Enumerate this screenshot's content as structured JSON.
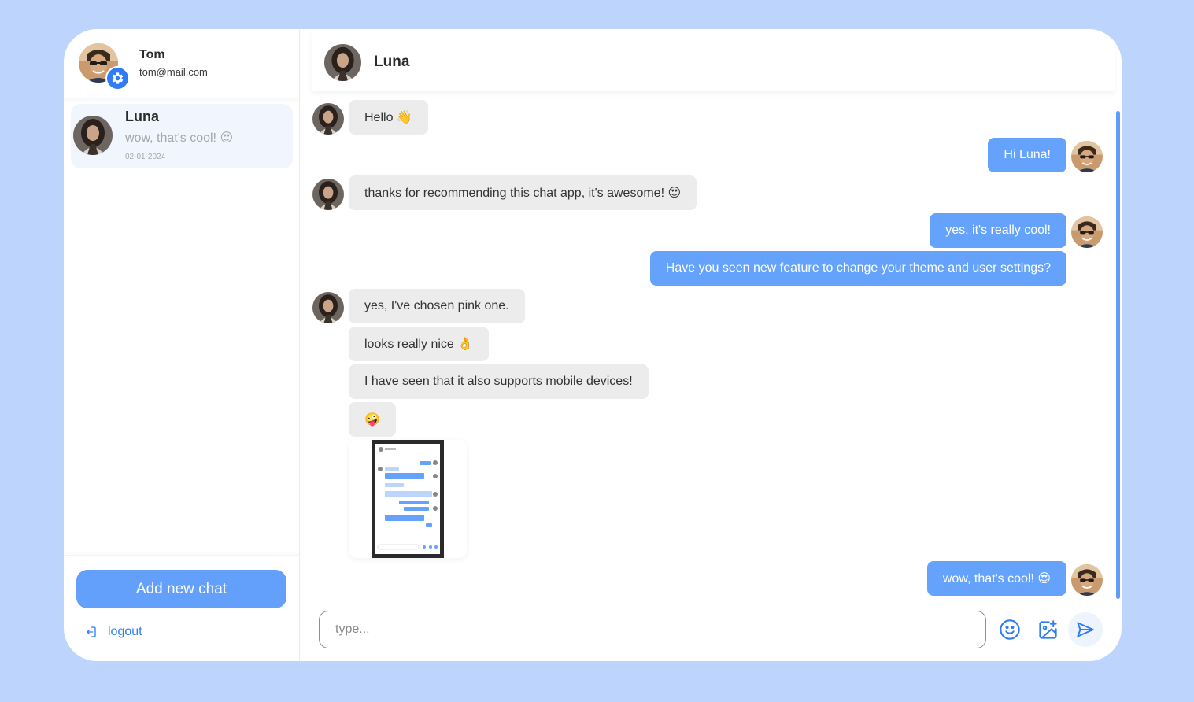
{
  "user": {
    "name": "Tom",
    "email": "tom@mail.com"
  },
  "sidebar": {
    "chats": [
      {
        "name": "Luna",
        "preview": "wow, that's cool! 😍",
        "date": "02-01-2024"
      }
    ],
    "add_chat_label": "Add new chat",
    "logout_label": "logout"
  },
  "chat": {
    "contact_name": "Luna",
    "messages": [
      {
        "from": "Luna",
        "text": "Hello 👋"
      },
      {
        "from": "Tom",
        "text": "Hi Luna!"
      },
      {
        "from": "Luna",
        "text": "thanks for recommending this chat app, it's awesome! 😍"
      },
      {
        "from": "Tom",
        "text": "yes, it's really cool!"
      },
      {
        "from": "Tom",
        "text": "Have you seen new feature to change your theme and user settings?"
      },
      {
        "from": "Luna",
        "text": "yes, I've chosen pink one."
      },
      {
        "from": "Luna",
        "text": "looks really nice 👌"
      },
      {
        "from": "Luna",
        "text": "I have seen that it also supports mobile devices!"
      },
      {
        "from": "Luna",
        "text": "🤪"
      },
      {
        "from": "Luna",
        "text": ""
      },
      {
        "from": "Tom",
        "text": "wow, that's cool! 😍"
      }
    ]
  },
  "composer": {
    "placeholder": "type..."
  },
  "icons": [
    "gear-icon",
    "logout-icon",
    "emoji-icon",
    "add-image-icon",
    "send-icon"
  ],
  "colors": {
    "background": "#bdd5fc",
    "accent": "#2f7cf6",
    "outgoing_bubble": "#64a2fc",
    "incoming_bubble": "#ececec"
  }
}
